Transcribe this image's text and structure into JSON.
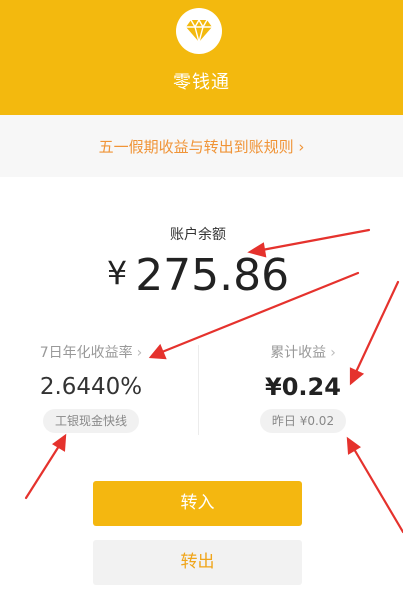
{
  "header": {
    "app_title": "零钱通",
    "logo_icon": "diamond-icon",
    "brand_color": "#f3b90e"
  },
  "notice": {
    "text": "五一假期收益与转出到账规则 ›"
  },
  "balance": {
    "label": "账户余额",
    "currency": "¥",
    "amount": "275.86"
  },
  "stats": {
    "yield": {
      "label": "7日年化收益率",
      "chevron": "›",
      "value": "2.6440%",
      "badge": "工银现金快线"
    },
    "earnings": {
      "label": "累计收益",
      "chevron": "›",
      "value": "¥0.24",
      "badge": "昨日 ¥0.02"
    }
  },
  "actions": {
    "deposit_label": "转入",
    "withdraw_label": "转出"
  },
  "annotation_color": "#e5322d"
}
